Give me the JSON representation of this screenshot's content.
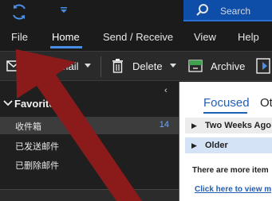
{
  "titlebar": {
    "search_placeholder": "Search",
    "sync_icon": "sync-icon",
    "quick_access_icon": "chevron-down-icon"
  },
  "ribbon": {
    "tabs": [
      {
        "label": "File"
      },
      {
        "label": "Home",
        "active": true
      },
      {
        "label": "Send / Receive"
      },
      {
        "label": "View"
      },
      {
        "label": "Help"
      }
    ]
  },
  "commands": {
    "new_email": "Email",
    "delete": "Delete",
    "archive": "Archive"
  },
  "folders": {
    "favorites_label": "Favorites",
    "items": [
      {
        "name": "收件箱",
        "count": "14",
        "selected": true
      },
      {
        "name": "已发送邮件",
        "count": ""
      },
      {
        "name": "已删除邮件",
        "count": ""
      }
    ]
  },
  "message_list": {
    "tab_focused": "Focused",
    "tab_other": "Ot",
    "groups": [
      {
        "label": "Two Weeks Ago"
      },
      {
        "label": "Older"
      }
    ],
    "more_items_text": "There are more item",
    "view_link": "Click here to view m"
  },
  "colors": {
    "accent": "#1f5fb5",
    "search_bg": "#0f4ea8",
    "arrow": "#8b1a1a",
    "unread_count": "#6fa8ff"
  }
}
